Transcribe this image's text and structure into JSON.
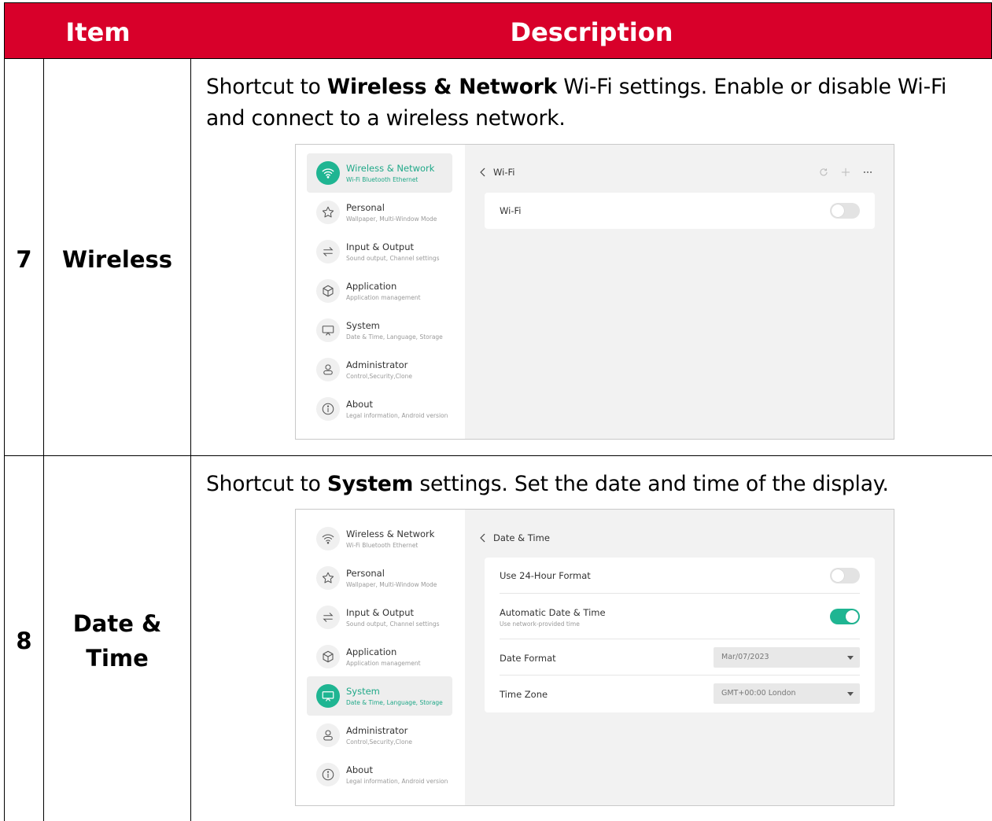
{
  "table": {
    "header": {
      "item": "Item",
      "description": "Description"
    },
    "rows": [
      {
        "number": "7",
        "item": "Wireless",
        "desc_parts": [
          "Shortcut to ",
          "Wireless & Network",
          " Wi-Fi settings. Enable or disable Wi-Fi",
          "and connect to a wireless network."
        ]
      },
      {
        "number": "8",
        "item_line1": "Date &",
        "item_line2": "Time",
        "desc_parts": [
          "Shortcut to ",
          "System",
          " settings. Set the date and time of the display."
        ]
      }
    ]
  },
  "menu": [
    {
      "title": "Wireless & Network",
      "subtitle": "Wi-Fi Bluetooth Ethernet",
      "icon": "wifi-icon"
    },
    {
      "title": "Personal",
      "subtitle": "Wallpaper, Multi-Window Mode",
      "icon": "star-icon"
    },
    {
      "title": "Input & Output",
      "subtitle": "Sound output, Channel settings",
      "icon": "swap-arrows-icon"
    },
    {
      "title": "Application",
      "subtitle": "Application management",
      "icon": "cube-icon"
    },
    {
      "title": "System",
      "subtitle": "Date & Time, Language, Storage",
      "icon": "monitor-icon"
    },
    {
      "title": "Administrator",
      "subtitle": "Control,Security,Clone",
      "icon": "user-icon"
    },
    {
      "title": "About",
      "subtitle": "Legal information, Android version",
      "icon": "info-icon"
    }
  ],
  "screen1": {
    "active_menu": "Wireless & Network",
    "title": "Wi-Fi",
    "header_icons": [
      "refresh-icon",
      "plus-icon",
      "more-icon"
    ],
    "wifi_label": "Wi-Fi",
    "wifi_enabled": false
  },
  "screen2": {
    "active_menu": "System",
    "title": "Date & Time",
    "use_24h_label": "Use 24-Hour Format",
    "use_24h_enabled": false,
    "auto_label": "Automatic Date & Time",
    "auto_sub": "Use network-provided time",
    "auto_enabled": true,
    "date_format_label": "Date Format",
    "date_format_value": "Mar/07/2023",
    "time_zone_label": "Time Zone",
    "time_zone_value": "GMT+00:00 London"
  },
  "colors": {
    "header_red": "#d8002a",
    "accent_teal": "#1fb592"
  }
}
